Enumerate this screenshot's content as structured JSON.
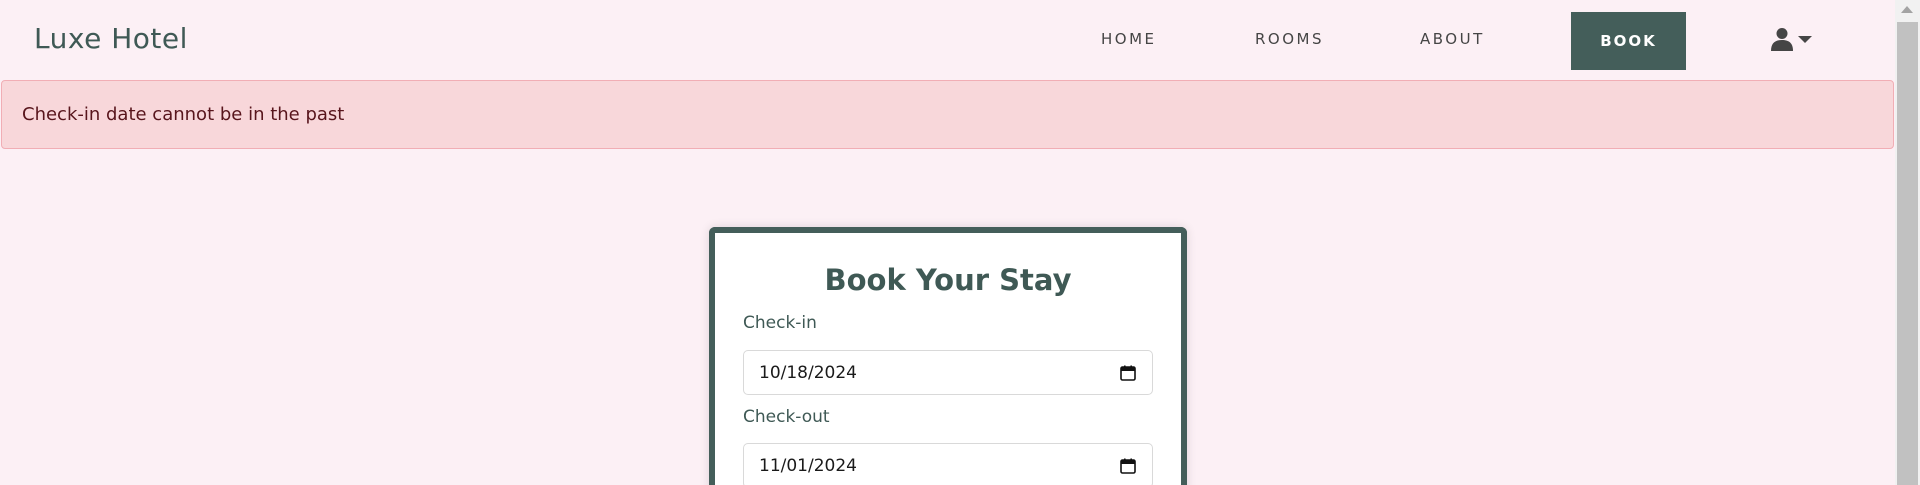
{
  "navbar": {
    "brand": "Luxe Hotel",
    "links": {
      "home": "HOME",
      "rooms": "ROOMS",
      "about": "ABOUT",
      "book": "BOOK"
    },
    "user_menu_icon": "user-icon",
    "caret_icon": "caret-down-icon"
  },
  "alert": {
    "message": "Check-in date cannot be in the past"
  },
  "booking_form": {
    "title": "Book Your Stay",
    "checkin_label": "Check-in",
    "checkin_value": "10/18/2024",
    "checkout_label": "Check-out",
    "checkout_value": "11/01/2024",
    "date_icon": "calendar-icon"
  },
  "colors": {
    "primary": "#445e5a",
    "page_bg": "#fcf0f5",
    "alert_bg": "#f8d7da",
    "alert_text": "#58151c"
  }
}
